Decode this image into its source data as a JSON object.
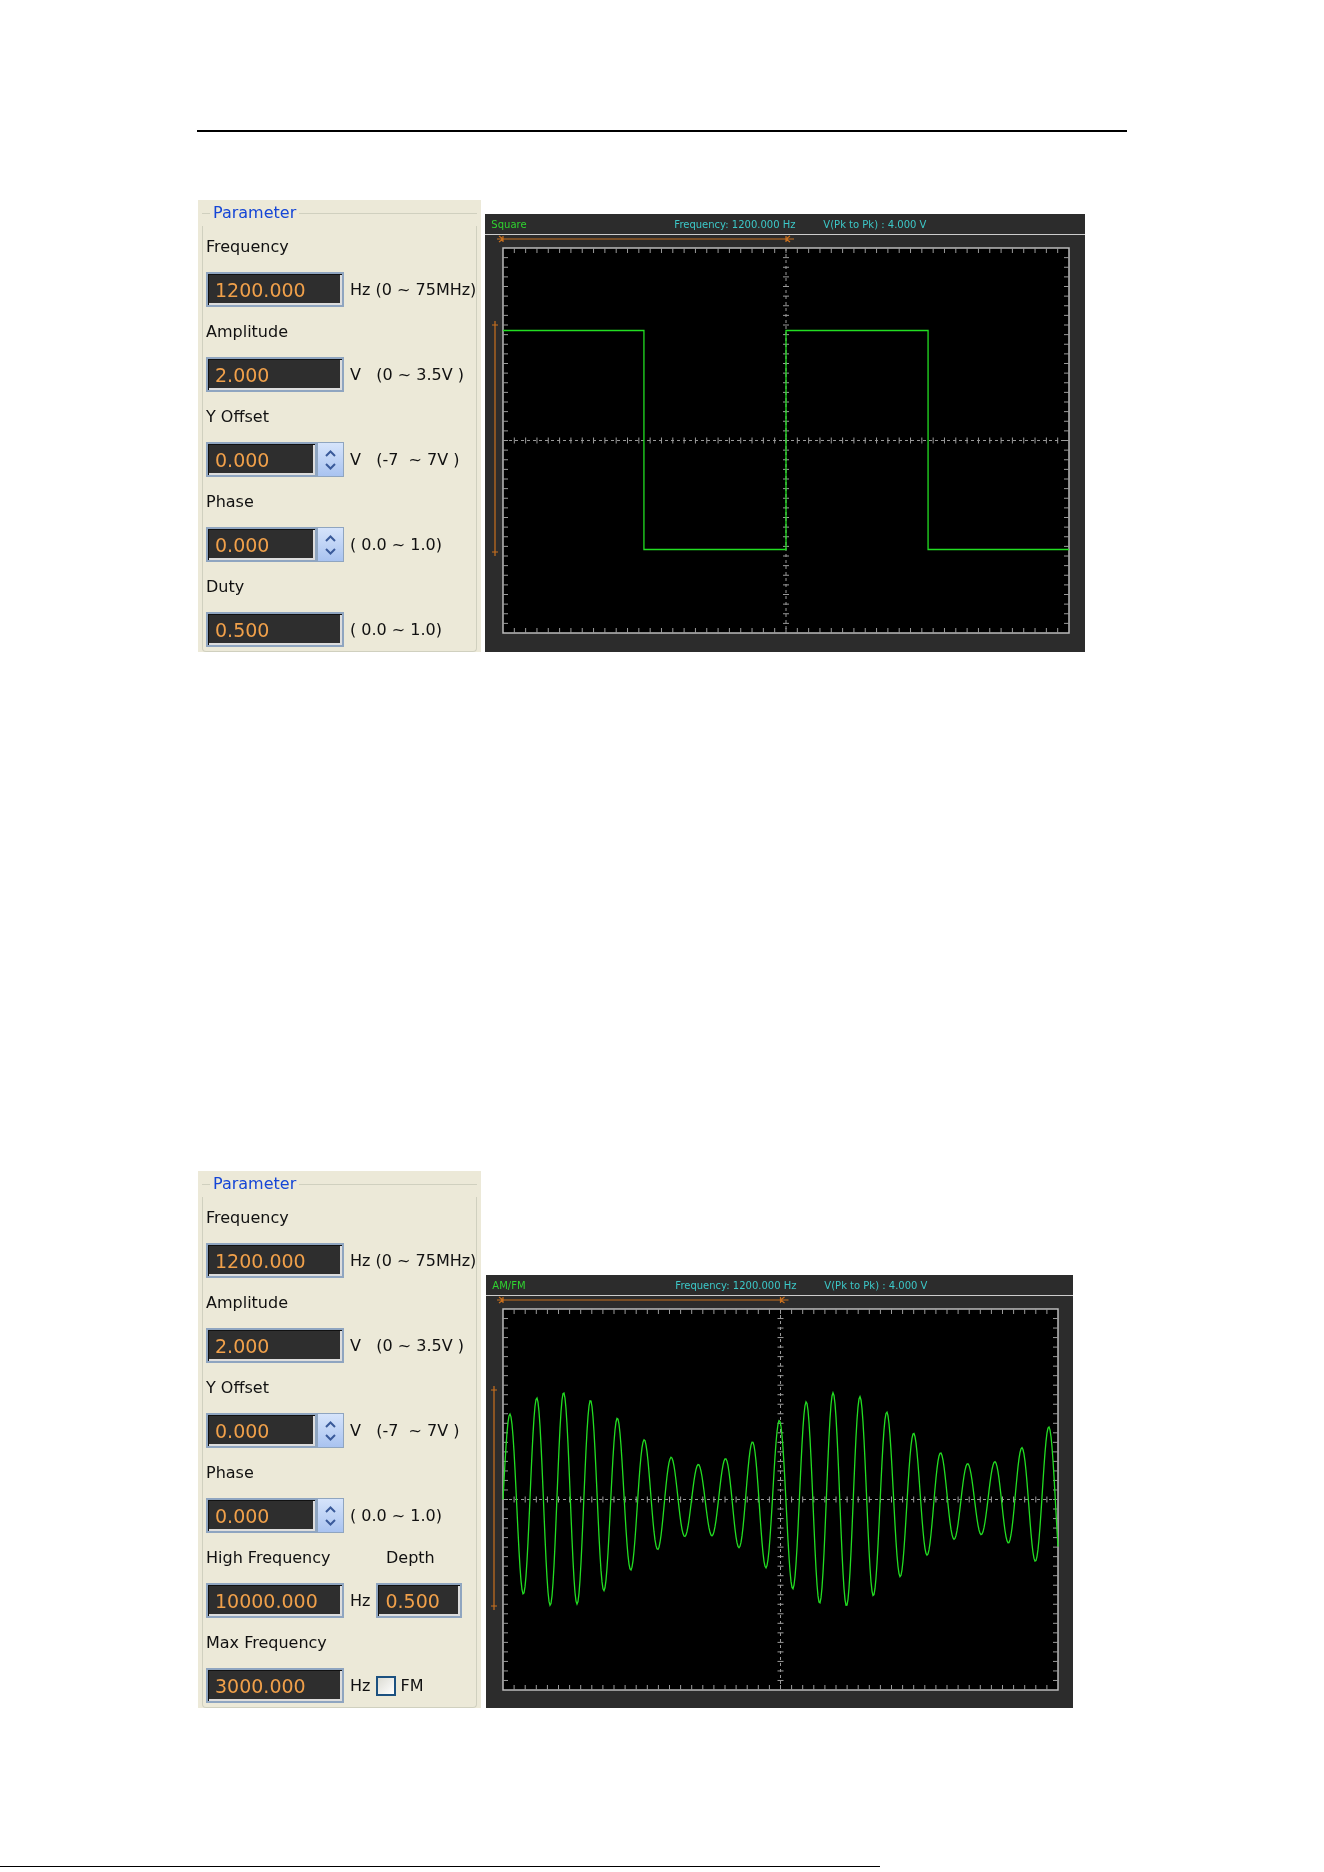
{
  "sections": [
    {
      "parameters": {
        "title": "Parameter",
        "rows": [
          [
            {
              "kind": "label",
              "text": "Frequency"
            }
          ],
          [
            {
              "kind": "field",
              "value": "1200.000"
            },
            {
              "kind": "unit",
              "text": "Hz (0 ~ 75MHz)"
            }
          ],
          [
            {
              "kind": "label",
              "text": "Amplitude"
            }
          ],
          [
            {
              "kind": "field",
              "value": "2.000"
            },
            {
              "kind": "unit",
              "text": "V   (0 ~ 3.5V )"
            }
          ],
          [
            {
              "kind": "label",
              "text": "Y Offset"
            }
          ],
          [
            {
              "kind": "spin",
              "value": "0.000"
            },
            {
              "kind": "unit",
              "text": "V   (-7  ~ 7V )"
            }
          ],
          [
            {
              "kind": "label",
              "text": "Phase"
            }
          ],
          [
            {
              "kind": "spin",
              "value": "0.000"
            },
            {
              "kind": "unit",
              "text": "( 0.0 ~ 1.0)"
            }
          ],
          [
            {
              "kind": "label",
              "text": "Duty"
            }
          ],
          [
            {
              "kind": "field",
              "value": "0.500"
            },
            {
              "kind": "unit",
              "text": "( 0.0 ~ 1.0)"
            }
          ]
        ]
      },
      "scope": {
        "kind": "square",
        "waveform": "Square",
        "frequency": "Frequency: 1200.000 Hz",
        "vpp": "V(Pk to Pk) : 4.000 V"
      }
    },
    {
      "parameters": {
        "title": "Parameter",
        "rows": [
          [
            {
              "kind": "label",
              "text": "Frequency"
            }
          ],
          [
            {
              "kind": "field",
              "value": "1200.000"
            },
            {
              "kind": "unit",
              "text": "Hz (0 ~ 75MHz)"
            }
          ],
          [
            {
              "kind": "label",
              "text": "Amplitude"
            }
          ],
          [
            {
              "kind": "field",
              "value": "2.000"
            },
            {
              "kind": "unit",
              "text": "V   (0 ~ 3.5V )"
            }
          ],
          [
            {
              "kind": "label",
              "text": "Y Offset"
            }
          ],
          [
            {
              "kind": "spin",
              "value": "0.000"
            },
            {
              "kind": "unit",
              "text": "V   (-7  ~ 7V )"
            }
          ],
          [
            {
              "kind": "label",
              "text": "Phase"
            }
          ],
          [
            {
              "kind": "spin",
              "value": "0.000"
            },
            {
              "kind": "unit",
              "text": "( 0.0 ~ 1.0)"
            }
          ],
          [
            {
              "kind": "label",
              "text": "High Frequency"
            },
            {
              "kind": "label",
              "text": "Depth"
            }
          ],
          [
            {
              "kind": "field",
              "value": "10000.000"
            },
            {
              "kind": "unit",
              "text": "Hz"
            },
            {
              "kind": "small-field",
              "value": "0.500"
            }
          ],
          [
            {
              "kind": "label",
              "text": "Max Frequency"
            }
          ],
          [
            {
              "kind": "field",
              "value": "3000.000"
            },
            {
              "kind": "unit",
              "text": "Hz"
            },
            {
              "kind": "checkbox",
              "label": "FM",
              "checked": false
            }
          ]
        ]
      },
      "scope": {
        "kind": "am",
        "waveform": "AM/FM",
        "frequency": "Frequency: 1200.000 Hz",
        "vpp": "V(Pk to Pk) : 4.000 V"
      }
    }
  ]
}
